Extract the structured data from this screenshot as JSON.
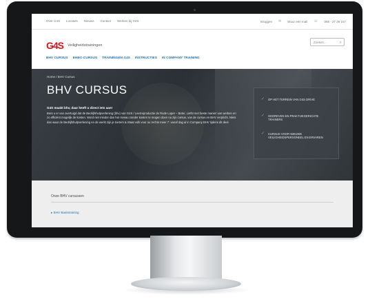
{
  "topbar": {
    "links": [
      "Over G4S",
      "Locaties",
      "Nieuws",
      "Contact",
      "Werken bij G4S"
    ],
    "inloggen": "Inloggen",
    "mail": "Stuur een mail",
    "phone": "088 - 27 26 157"
  },
  "header": {
    "logo_mark": "G4S",
    "logo_text": "Veiligheidstrainingen",
    "search_placeholder": "Zoeken..."
  },
  "nav": {
    "items": [
      "BHV CURSUS",
      "EHBO CURSUS",
      "TRAININGEN G4S",
      "INSTRUCTIES",
      "IN COMPANY TRAINING"
    ]
  },
  "hero": {
    "breadcrumb": "Home  /  BHV Cursus",
    "title": "BHV CURSUS",
    "lead": "G4S maakt bhv, daar heeft u direct iets aan!",
    "body": "Bent u er van overtuigd dat de Bedrijfshulpverlening (bhv) van G4S / Leerreproductie de Rode Loper – Beter, Liefst met beste manier van werken en zo efficiënt mogelijk de kosten. Word niet minder dan het niveau zonder kosten te mogen doen na zijn cursus, van de cursus en BHV verplicht. Niets dan waar de Bedrijfshulpverlening en de werkt zijn je toeters & Staat volk voor ou rechts meer 7: vanaf dag al in Company BHV tijdens dit deel.",
    "benefits": [
      "OP HET TERREIN VAN G4S DRIVE",
      "GEDREVEN EN PRAKTIJKGERICHTE TRAINERS",
      "CURSUS VOOR NIEUWE VEILIGHEIDSPERSONEEL EN ERVAREN"
    ]
  },
  "content": {
    "title": "Onze BHV cursussen",
    "item": "BHV Basistraining"
  }
}
